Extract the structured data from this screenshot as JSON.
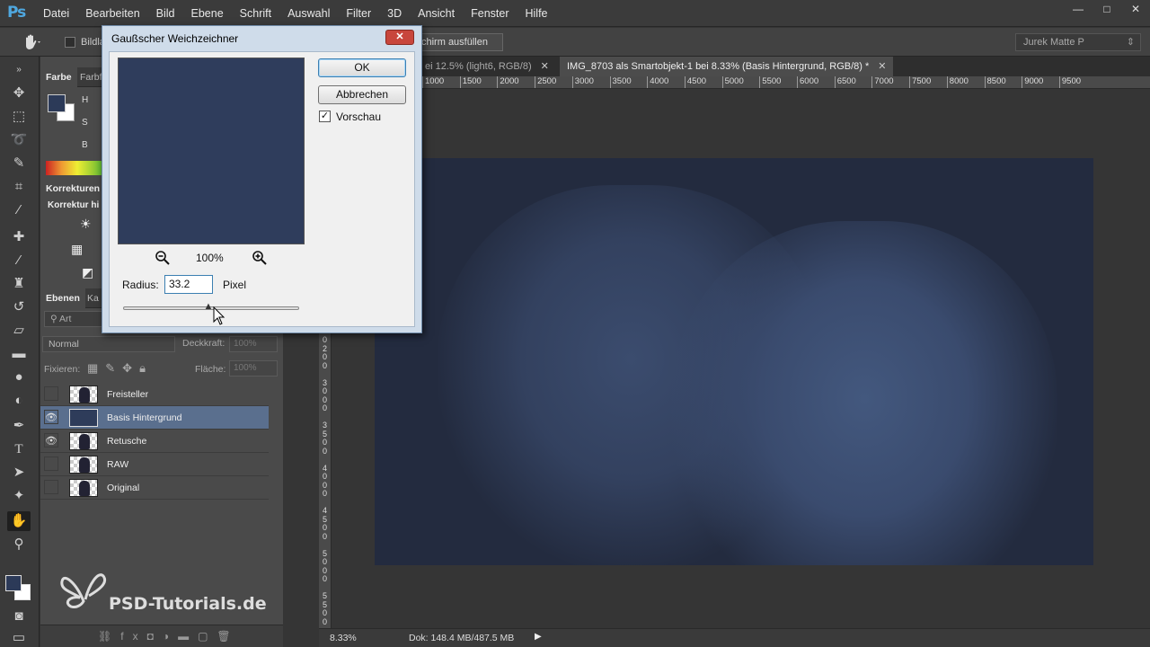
{
  "app": {
    "logo": "Ps",
    "menus": [
      "Datei",
      "Bearbeiten",
      "Bild",
      "Ebene",
      "Schrift",
      "Auswahl",
      "Filter",
      "3D",
      "Ansicht",
      "Fenster",
      "Hilfe"
    ],
    "window_controls": [
      "—",
      "□",
      "✕"
    ]
  },
  "options": {
    "checkbox_label": "Bildla",
    "fill_button": "chirm ausfüllen",
    "workspace": "Jurek Matte P"
  },
  "panels": {
    "color_tabs": [
      "Farbe",
      "Farbf"
    ],
    "hsb": [
      "H",
      "S",
      "B"
    ],
    "korr_tabs": [
      "Korrekturen"
    ],
    "korr_label": "Korrektur hi",
    "layer_tabs": [
      "Ebenen",
      "Ka"
    ],
    "search_placeholder": "Art",
    "blend_mode": "Normal",
    "opacity_label": "Deckkraft:",
    "opacity_value": "100%",
    "lock_label": "Fixieren:",
    "fill_label": "Fläche:",
    "fill_value": "100%"
  },
  "layers": [
    {
      "name": "Freisteller",
      "visible": false,
      "selected": false
    },
    {
      "name": "Basis Hintergrund",
      "visible": true,
      "selected": true
    },
    {
      "name": "Retusche",
      "visible": true,
      "selected": false
    },
    {
      "name": "RAW",
      "visible": false,
      "selected": false
    },
    {
      "name": "Original",
      "visible": false,
      "selected": false
    }
  ],
  "watermark": "PSD-Tutorials.de",
  "doc_tabs": [
    {
      "label": "ei 12.5% (light6, RGB/8)",
      "active": false
    },
    {
      "label": "IMG_8703 als Smartobjekt-1 bei 8.33% (Basis Hintergrund, RGB/8) *",
      "active": true
    }
  ],
  "ruler": [
    "1000",
    "1500",
    "2000",
    "2500",
    "3000",
    "3500",
    "4000",
    "4500",
    "5000",
    "5500",
    "6000",
    "6500",
    "7000",
    "7500",
    "8000",
    "8500",
    "9000",
    "9500"
  ],
  "status": {
    "zoom": "8.33%",
    "doc": "Dok: 148.4 MB/487.5 MB"
  },
  "dialog": {
    "title": "Gaußscher Weichzeichner",
    "ok": "OK",
    "cancel": "Abbrechen",
    "preview_label": "Vorschau",
    "zoom": "100%",
    "radius_label": "Radius:",
    "radius_value": "33.2",
    "radius_unit": "Pixel"
  },
  "colors": {
    "foreground": "#2c3a58",
    "background": "#ffffff",
    "canvas": "#232b3f",
    "selection": "#5a6f8e"
  }
}
